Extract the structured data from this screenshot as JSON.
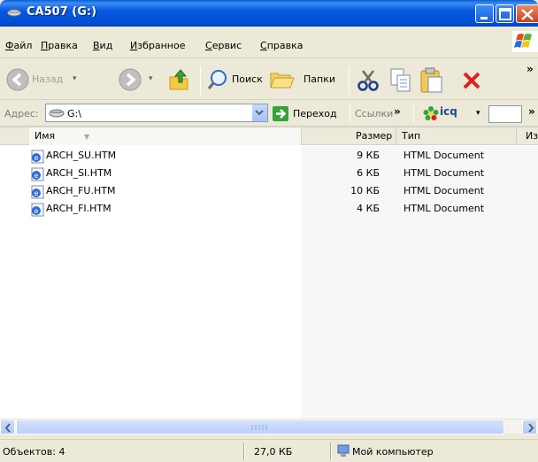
{
  "window": {
    "title": "CA507 (G:)"
  },
  "menu": [
    {
      "label": "Файл"
    },
    {
      "label": "Правка"
    },
    {
      "label": "Вид"
    },
    {
      "label": "Избранное"
    },
    {
      "label": "Сервис"
    },
    {
      "label": "Справка"
    }
  ],
  "toolbar": {
    "back_label": "Назад",
    "search_label": "Поиск",
    "folders_label": "Папки"
  },
  "address": {
    "label": "Адрес:",
    "value": "G:\\",
    "go_label": "Переход",
    "links_label": "Ссылки",
    "icq_label": "icq"
  },
  "columns": [
    {
      "label": "Имя"
    },
    {
      "label": "Размер"
    },
    {
      "label": "Тип"
    },
    {
      "label": "Из"
    }
  ],
  "files": [
    {
      "name": "ARCH_SU.HTM",
      "size": "9 КБ",
      "type": "HTML Document"
    },
    {
      "name": "ARCH_SI.HTM",
      "size": "6 КБ",
      "type": "HTML Document"
    },
    {
      "name": "ARCH_FU.HTM",
      "size": "10 КБ",
      "type": "HTML Document"
    },
    {
      "name": "ARCH_FI.HTM",
      "size": "4 КБ",
      "type": "HTML Document"
    }
  ],
  "status": {
    "objects": "Объектов: 4",
    "size": "27,0 КБ",
    "location": "Мой компьютер"
  },
  "icons": [
    "drive-icon",
    "back-icon",
    "forward-icon",
    "up-folder-icon",
    "search-icon",
    "folders-icon",
    "cut-icon",
    "copy-icon",
    "paste-icon",
    "delete-icon",
    "go-icon",
    "icq-flower-icon",
    "html-file-icon",
    "computer-icon",
    "windows-logo-icon"
  ]
}
